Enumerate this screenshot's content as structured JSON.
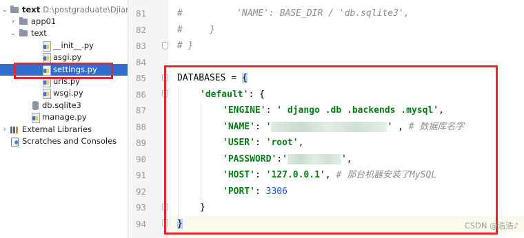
{
  "project_tree": {
    "root": {
      "name": "text",
      "path": "D:\\postgraduate\\Djian"
    },
    "items": [
      {
        "label": "app01",
        "kind": "folder"
      },
      {
        "label": "text",
        "kind": "folder"
      },
      {
        "label": "__init__.py",
        "kind": "python-file"
      },
      {
        "label": "asgi.py",
        "kind": "python-file"
      },
      {
        "label": "settings.py",
        "kind": "python-file",
        "selected": true
      },
      {
        "label": "urls.py",
        "kind": "python-file"
      },
      {
        "label": "wsgi.py",
        "kind": "python-file"
      },
      {
        "label": "db.sqlite3",
        "kind": "database-file"
      },
      {
        "label": "manage.py",
        "kind": "python-file"
      },
      {
        "label": "External Libraries",
        "kind": "libraries"
      },
      {
        "label": "Scratches and Consoles",
        "kind": "scratches"
      }
    ]
  },
  "editor": {
    "line_numbers": [
      "81",
      "82",
      "83",
      "84",
      "85",
      "86",
      "87",
      "88",
      "89",
      "90",
      "91",
      "92",
      "93",
      "94"
    ],
    "lines": {
      "l81_comment": "#          'NAME': BASE_DIR / 'db.sqlite3',",
      "l82_comment": "#     }",
      "l83_comment": "# }",
      "l85_name": "DATABASES",
      "l85_eq": " = ",
      "l85_brace": "{",
      "l86_key": "'default'",
      "l86_rest": ": {",
      "l87_key": "'ENGINE'",
      "l87_sep": ": ",
      "l87_value": "' django .db .backends .mysql'",
      "l87_end": ",",
      "l88_key": "'NAME'",
      "l88_sep": ": ",
      "l88_open": "'",
      "l88_close": "'",
      "l88_end": " , ",
      "l88_comment": "# 数据库名字",
      "l89_key": "'USER'",
      "l89_sep": ": ",
      "l89_value": "'root'",
      "l89_end": ",",
      "l90_key": "'PASSWORD'",
      "l90_sep": ":",
      "l90_open": "'",
      "l90_close": "'",
      "l90_end": ",",
      "l91_key": "'HOST'",
      "l91_sep": ": ",
      "l91_value": "'127.0.0.1'",
      "l91_end": ", ",
      "l91_comment": "# 那台机器安装了MySQL",
      "l92_key": "'PORT'",
      "l92_sep": ": ",
      "l92_value": "3306",
      "l93_brace": "}",
      "l94_brace": "}"
    }
  },
  "watermark": "CSDN @浩浩♪",
  "colors": {
    "selection": "#2f6fd1",
    "highlight_box": "#e0262e",
    "string": "#067d17",
    "number": "#1750eb",
    "comment": "#8c8c8c",
    "current_line": "#fcfaed"
  }
}
